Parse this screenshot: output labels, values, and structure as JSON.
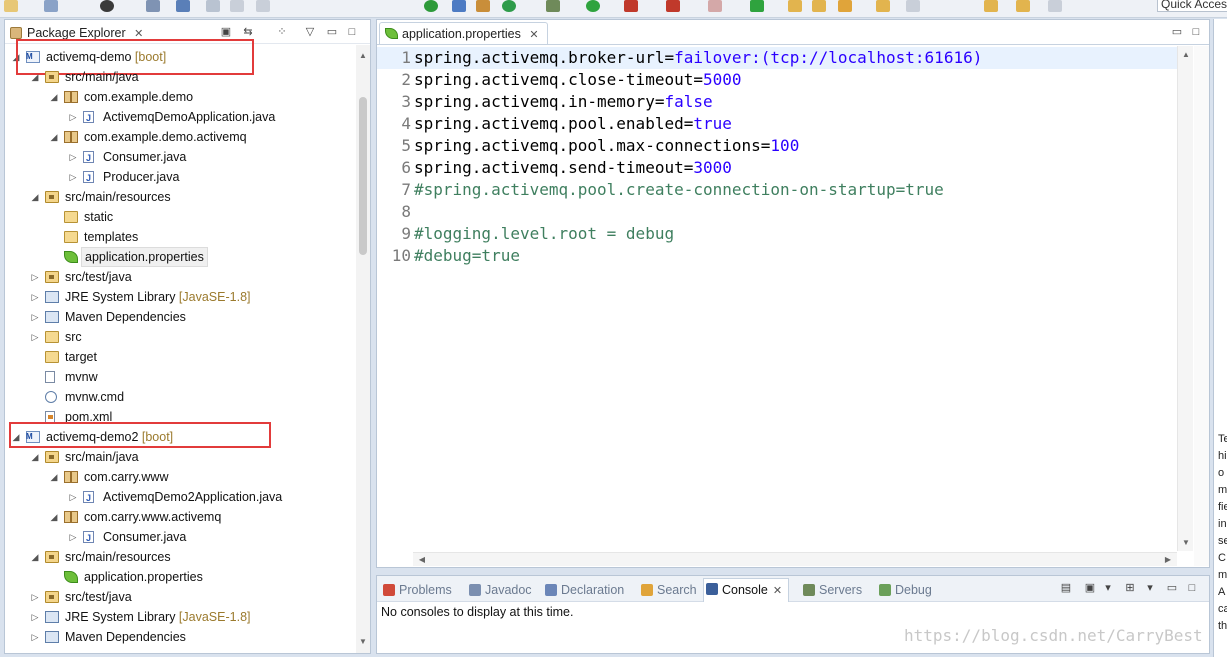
{
  "toolbar": {
    "quick_access": "Quick Access"
  },
  "package_explorer": {
    "tab_label": "Package Explorer",
    "close_glyph": "✕",
    "tree": [
      {
        "label": "activemq-demo",
        "decor": "[boot]",
        "icon": "maven-project-icon",
        "depth": 0,
        "twisty": "expanded",
        "boxed": true
      },
      {
        "label": "src/main/java",
        "icon": "source-folder-icon",
        "depth": 1,
        "twisty": "expanded"
      },
      {
        "label": "com.example.demo",
        "icon": "package-icon",
        "depth": 2,
        "twisty": "expanded"
      },
      {
        "label": "ActivemqDemoApplication.java",
        "icon": "java-file-icon",
        "depth": 3,
        "twisty": "collapsed"
      },
      {
        "label": "com.example.demo.activemq",
        "icon": "package-icon",
        "depth": 2,
        "twisty": "expanded"
      },
      {
        "label": "Consumer.java",
        "icon": "java-file-icon",
        "depth": 3,
        "twisty": "collapsed"
      },
      {
        "label": "Producer.java",
        "icon": "java-file-icon",
        "depth": 3,
        "twisty": "collapsed"
      },
      {
        "label": "src/main/resources",
        "icon": "source-folder-icon",
        "depth": 1,
        "twisty": "expanded"
      },
      {
        "label": "static",
        "icon": "folder-icon",
        "depth": 2,
        "twisty": "none"
      },
      {
        "label": "templates",
        "icon": "folder-icon",
        "depth": 2,
        "twisty": "none"
      },
      {
        "label": "application.properties",
        "icon": "spring-leaf-icon",
        "depth": 2,
        "twisty": "none",
        "highlighted": true
      },
      {
        "label": "src/test/java",
        "icon": "source-folder-icon",
        "depth": 1,
        "twisty": "collapsed"
      },
      {
        "label": "JRE System Library",
        "decor": "[JavaSE-1.8]",
        "icon": "library-icon",
        "depth": 1,
        "twisty": "collapsed"
      },
      {
        "label": "Maven Dependencies",
        "icon": "library-icon",
        "depth": 1,
        "twisty": "collapsed"
      },
      {
        "label": "src",
        "icon": "folder-icon",
        "depth": 1,
        "twisty": "collapsed"
      },
      {
        "label": "target",
        "icon": "folder-icon",
        "depth": 1,
        "twisty": "none"
      },
      {
        "label": "mvnw",
        "icon": "file-icon",
        "depth": 1,
        "twisty": "none"
      },
      {
        "label": "mvnw.cmd",
        "icon": "gear-file-icon",
        "depth": 1,
        "twisty": "none"
      },
      {
        "label": "pom.xml",
        "icon": "xml-file-icon",
        "depth": 1,
        "twisty": "none"
      },
      {
        "label": "activemq-demo2",
        "decor": "[boot]",
        "icon": "maven-project-icon",
        "depth": 0,
        "twisty": "expanded",
        "boxed": true
      },
      {
        "label": "src/main/java",
        "icon": "source-folder-icon",
        "depth": 1,
        "twisty": "expanded"
      },
      {
        "label": "com.carry.www",
        "icon": "package-icon",
        "depth": 2,
        "twisty": "expanded"
      },
      {
        "label": "ActivemqDemo2Application.java",
        "icon": "java-file-icon",
        "depth": 3,
        "twisty": "collapsed"
      },
      {
        "label": "com.carry.www.activemq",
        "icon": "package-icon",
        "depth": 2,
        "twisty": "expanded"
      },
      {
        "label": "Consumer.java",
        "icon": "java-file-icon",
        "depth": 3,
        "twisty": "collapsed"
      },
      {
        "label": "src/main/resources",
        "icon": "source-folder-icon",
        "depth": 1,
        "twisty": "expanded"
      },
      {
        "label": "application.properties",
        "icon": "spring-leaf-icon",
        "depth": 2,
        "twisty": "none"
      },
      {
        "label": "src/test/java",
        "icon": "source-folder-icon",
        "depth": 1,
        "twisty": "collapsed"
      },
      {
        "label": "JRE System Library",
        "decor": "[JavaSE-1.8]",
        "icon": "library-icon",
        "depth": 1,
        "twisty": "collapsed"
      },
      {
        "label": "Maven Dependencies",
        "icon": "library-icon",
        "depth": 1,
        "twisty": "collapsed"
      }
    ]
  },
  "editor": {
    "tab_label": "application.properties",
    "close_glyph": "✕",
    "lines": [
      {
        "n": "1",
        "key": "spring.activemq.broker-url=",
        "value": "failover:(tcp://localhost:61616)",
        "comment": false
      },
      {
        "n": "2",
        "key": "spring.activemq.close-timeout=",
        "value": "5000",
        "comment": false
      },
      {
        "n": "3",
        "key": "spring.activemq.in-memory=",
        "value": "false",
        "comment": false
      },
      {
        "n": "4",
        "key": "spring.activemq.pool.enabled=",
        "value": "true",
        "comment": false
      },
      {
        "n": "5",
        "key": "spring.activemq.pool.max-connections=",
        "value": "100",
        "comment": false
      },
      {
        "n": "6",
        "key": "spring.activemq.send-timeout=",
        "value": "3000",
        "comment": false
      },
      {
        "n": "7",
        "key": "#spring.activemq.pool.create-connection-on-startup=true",
        "value": "",
        "comment": true
      },
      {
        "n": "8",
        "key": "",
        "value": "",
        "comment": false
      },
      {
        "n": "9",
        "key": "#logging.level.root = debug",
        "value": "",
        "comment": true
      },
      {
        "n": "10",
        "key": "#debug=true",
        "value": "",
        "comment": true
      }
    ]
  },
  "console": {
    "tabs": [
      {
        "label": "Problems",
        "name": "tab-problems",
        "icon": "problems-icon",
        "color": "#d04a3a"
      },
      {
        "label": "Javadoc",
        "name": "tab-javadoc",
        "icon": "javadoc-icon",
        "color": "#7b8fb0"
      },
      {
        "label": "Declaration",
        "name": "tab-declaration",
        "icon": "declaration-icon",
        "color": "#6b86b8"
      },
      {
        "label": "Search",
        "name": "tab-search",
        "icon": "search-icon",
        "color": "#e0a43a"
      },
      {
        "label": "Console",
        "name": "tab-console",
        "icon": "console-icon",
        "color": "#3b5f9a",
        "active": true
      },
      {
        "label": "Servers",
        "name": "tab-servers",
        "icon": "servers-icon",
        "color": "#6f8a5a"
      },
      {
        "label": "Debug",
        "name": "tab-debug",
        "icon": "debug-icon",
        "color": "#6ba05a"
      }
    ],
    "message": "No consoles to display at this time."
  },
  "right_panel_text": [
    "Te",
    "hi",
    "o",
    "m",
    "fie",
    "in",
    "se",
    "C",
    "m",
    "A",
    "ca",
    "th"
  ],
  "watermark": "https://blog.csdn.net/CarryBest"
}
